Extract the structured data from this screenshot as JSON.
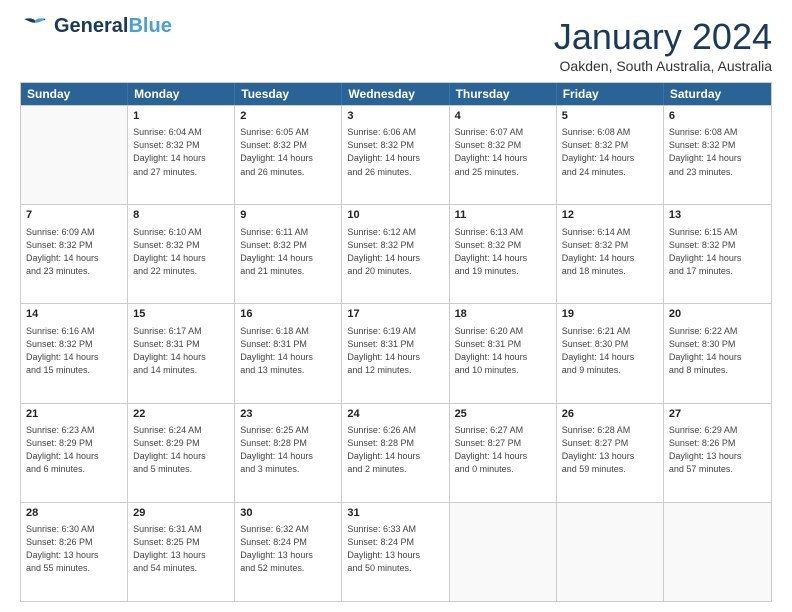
{
  "logo": {
    "line1": "General",
    "line2": "Blue"
  },
  "title": "January 2024",
  "subtitle": "Oakden, South Australia, Australia",
  "weekdays": [
    "Sunday",
    "Monday",
    "Tuesday",
    "Wednesday",
    "Thursday",
    "Friday",
    "Saturday"
  ],
  "weeks": [
    [
      {
        "day": "",
        "info": ""
      },
      {
        "day": "1",
        "info": "Sunrise: 6:04 AM\nSunset: 8:32 PM\nDaylight: 14 hours\nand 27 minutes."
      },
      {
        "day": "2",
        "info": "Sunrise: 6:05 AM\nSunset: 8:32 PM\nDaylight: 14 hours\nand 26 minutes."
      },
      {
        "day": "3",
        "info": "Sunrise: 6:06 AM\nSunset: 8:32 PM\nDaylight: 14 hours\nand 26 minutes."
      },
      {
        "day": "4",
        "info": "Sunrise: 6:07 AM\nSunset: 8:32 PM\nDaylight: 14 hours\nand 25 minutes."
      },
      {
        "day": "5",
        "info": "Sunrise: 6:08 AM\nSunset: 8:32 PM\nDaylight: 14 hours\nand 24 minutes."
      },
      {
        "day": "6",
        "info": "Sunrise: 6:08 AM\nSunset: 8:32 PM\nDaylight: 14 hours\nand 23 minutes."
      }
    ],
    [
      {
        "day": "7",
        "info": "Sunrise: 6:09 AM\nSunset: 8:32 PM\nDaylight: 14 hours\nand 23 minutes."
      },
      {
        "day": "8",
        "info": "Sunrise: 6:10 AM\nSunset: 8:32 PM\nDaylight: 14 hours\nand 22 minutes."
      },
      {
        "day": "9",
        "info": "Sunrise: 6:11 AM\nSunset: 8:32 PM\nDaylight: 14 hours\nand 21 minutes."
      },
      {
        "day": "10",
        "info": "Sunrise: 6:12 AM\nSunset: 8:32 PM\nDaylight: 14 hours\nand 20 minutes."
      },
      {
        "day": "11",
        "info": "Sunrise: 6:13 AM\nSunset: 8:32 PM\nDaylight: 14 hours\nand 19 minutes."
      },
      {
        "day": "12",
        "info": "Sunrise: 6:14 AM\nSunset: 8:32 PM\nDaylight: 14 hours\nand 18 minutes."
      },
      {
        "day": "13",
        "info": "Sunrise: 6:15 AM\nSunset: 8:32 PM\nDaylight: 14 hours\nand 17 minutes."
      }
    ],
    [
      {
        "day": "14",
        "info": "Sunrise: 6:16 AM\nSunset: 8:32 PM\nDaylight: 14 hours\nand 15 minutes."
      },
      {
        "day": "15",
        "info": "Sunrise: 6:17 AM\nSunset: 8:31 PM\nDaylight: 14 hours\nand 14 minutes."
      },
      {
        "day": "16",
        "info": "Sunrise: 6:18 AM\nSunset: 8:31 PM\nDaylight: 14 hours\nand 13 minutes."
      },
      {
        "day": "17",
        "info": "Sunrise: 6:19 AM\nSunset: 8:31 PM\nDaylight: 14 hours\nand 12 minutes."
      },
      {
        "day": "18",
        "info": "Sunrise: 6:20 AM\nSunset: 8:31 PM\nDaylight: 14 hours\nand 10 minutes."
      },
      {
        "day": "19",
        "info": "Sunrise: 6:21 AM\nSunset: 8:30 PM\nDaylight: 14 hours\nand 9 minutes."
      },
      {
        "day": "20",
        "info": "Sunrise: 6:22 AM\nSunset: 8:30 PM\nDaylight: 14 hours\nand 8 minutes."
      }
    ],
    [
      {
        "day": "21",
        "info": "Sunrise: 6:23 AM\nSunset: 8:29 PM\nDaylight: 14 hours\nand 6 minutes."
      },
      {
        "day": "22",
        "info": "Sunrise: 6:24 AM\nSunset: 8:29 PM\nDaylight: 14 hours\nand 5 minutes."
      },
      {
        "day": "23",
        "info": "Sunrise: 6:25 AM\nSunset: 8:28 PM\nDaylight: 14 hours\nand 3 minutes."
      },
      {
        "day": "24",
        "info": "Sunrise: 6:26 AM\nSunset: 8:28 PM\nDaylight: 14 hours\nand 2 minutes."
      },
      {
        "day": "25",
        "info": "Sunrise: 6:27 AM\nSunset: 8:27 PM\nDaylight: 14 hours\nand 0 minutes."
      },
      {
        "day": "26",
        "info": "Sunrise: 6:28 AM\nSunset: 8:27 PM\nDaylight: 13 hours\nand 59 minutes."
      },
      {
        "day": "27",
        "info": "Sunrise: 6:29 AM\nSunset: 8:26 PM\nDaylight: 13 hours\nand 57 minutes."
      }
    ],
    [
      {
        "day": "28",
        "info": "Sunrise: 6:30 AM\nSunset: 8:26 PM\nDaylight: 13 hours\nand 55 minutes."
      },
      {
        "day": "29",
        "info": "Sunrise: 6:31 AM\nSunset: 8:25 PM\nDaylight: 13 hours\nand 54 minutes."
      },
      {
        "day": "30",
        "info": "Sunrise: 6:32 AM\nSunset: 8:24 PM\nDaylight: 13 hours\nand 52 minutes."
      },
      {
        "day": "31",
        "info": "Sunrise: 6:33 AM\nSunset: 8:24 PM\nDaylight: 13 hours\nand 50 minutes."
      },
      {
        "day": "",
        "info": ""
      },
      {
        "day": "",
        "info": ""
      },
      {
        "day": "",
        "info": ""
      }
    ]
  ]
}
